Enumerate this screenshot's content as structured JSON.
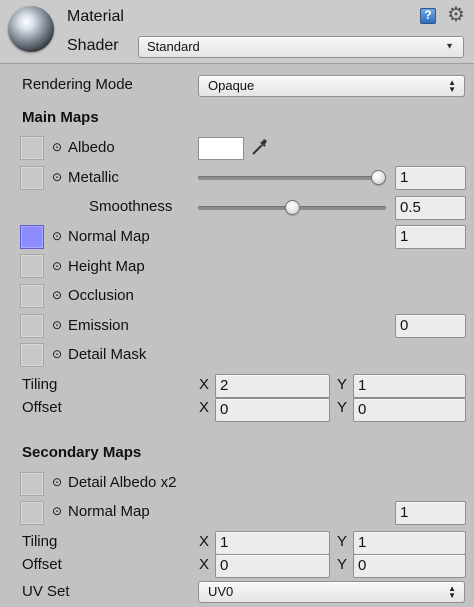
{
  "header": {
    "title": "Material",
    "shader_label": "Shader",
    "shader_value": "Standard",
    "help_icon": "help-book-icon",
    "settings_icon": "gear-icon",
    "preview_icon": "material-preview-sphere"
  },
  "rendering": {
    "label": "Rendering Mode",
    "value": "Opaque"
  },
  "main_maps": {
    "title": "Main Maps",
    "albedo": {
      "label": "Albedo",
      "color": "#ffffff"
    },
    "metallic": {
      "label": "Metallic",
      "value": "1",
      "slider_fraction": 1
    },
    "smoothness": {
      "label": "Smoothness",
      "value": "0.5",
      "slider_fraction": 0.5
    },
    "normal_map": {
      "label": "Normal Map",
      "value": "1",
      "thumb_color": "#8d8cff"
    },
    "height_map": {
      "label": "Height Map"
    },
    "occlusion": {
      "label": "Occlusion"
    },
    "emission": {
      "label": "Emission",
      "value": "0"
    },
    "detail_mask": {
      "label": "Detail Mask"
    },
    "tiling": {
      "label": "Tiling",
      "x_label": "X",
      "x": "2",
      "y_label": "Y",
      "y": "1"
    },
    "offset": {
      "label": "Offset",
      "x_label": "X",
      "x": "0",
      "y_label": "Y",
      "y": "0"
    }
  },
  "secondary_maps": {
    "title": "Secondary Maps",
    "detail_albedo": {
      "label": "Detail Albedo x2"
    },
    "normal_map": {
      "label": "Normal Map",
      "value": "1"
    },
    "tiling": {
      "label": "Tiling",
      "x_label": "X",
      "x": "1",
      "y_label": "Y",
      "y": "1"
    },
    "offset": {
      "label": "Offset",
      "x_label": "X",
      "x": "0",
      "y_label": "Y",
      "y": "0"
    },
    "uv_set": {
      "label": "UV Set",
      "value": "UV0"
    }
  },
  "icons": {
    "map_prefix": "⊙"
  }
}
